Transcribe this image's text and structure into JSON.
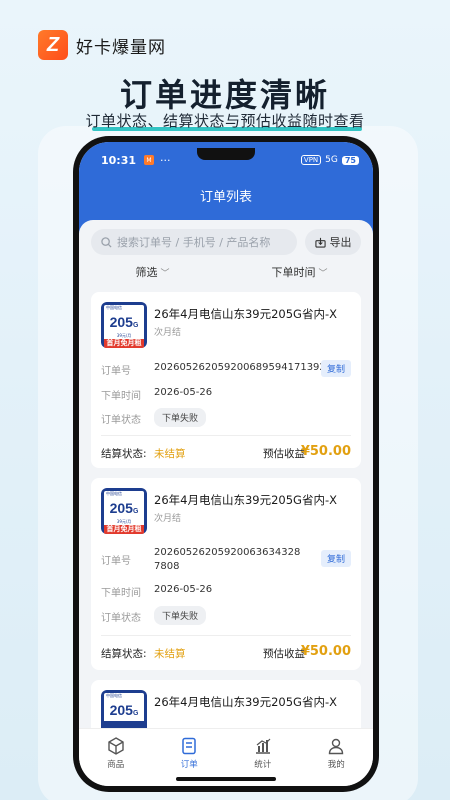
{
  "brand": {
    "logo_letter": "Z",
    "name": "好卡爆量网"
  },
  "headline": "订单进度清晰",
  "subline": "订单状态、结算状态与预估收益随时查看",
  "status_bar": {
    "time": "10:31",
    "app_badge": "M",
    "dots": "···",
    "vpn": "VPN",
    "signal": "5G",
    "battery": "75"
  },
  "page_title": "订单列表",
  "search": {
    "placeholder": "搜索订单号 / 手机号 / 产品名称",
    "export_label": "导出"
  },
  "filters": {
    "filter_label": "筛选",
    "time_label": "下单时间"
  },
  "labels": {
    "order_no": "订单号",
    "order_time": "下单时间",
    "order_status": "订单状态",
    "copy": "复制",
    "settle_status": "结算状态:",
    "est_income": "预估收益"
  },
  "thumb": {
    "top": "中国电信",
    "big": "205",
    "big_unit": "G",
    "mid": "39元/月",
    "red": "首月免月租"
  },
  "orders": [
    {
      "title": "26年4月电信山东39元205G省内-X",
      "sub": "次月结",
      "order_no": "20260526205920068959417139​2",
      "order_time": "2026-05-26",
      "status": "下单失败",
      "settle": "未结算",
      "income": "¥50.00"
    },
    {
      "title": "26年4月电信山东39元205G省内-X",
      "sub": "次月结",
      "order_no": "202605262059200636343287808",
      "order_time": "2026-05-26",
      "status": "下单失败",
      "settle": "未结算",
      "income": "¥50.00"
    },
    {
      "title": "26年4月电信山东39元205G省内-X"
    }
  ],
  "tabs": [
    {
      "label": "商品",
      "icon": "box-icon"
    },
    {
      "label": "订单",
      "icon": "order-icon"
    },
    {
      "label": "统计",
      "icon": "chart-icon"
    },
    {
      "label": "我的",
      "icon": "user-icon"
    }
  ],
  "colors": {
    "primary": "#2f6bd8",
    "accent": "#e2a010",
    "brand": "#ff5a1f",
    "underline": "#33c4c4"
  }
}
